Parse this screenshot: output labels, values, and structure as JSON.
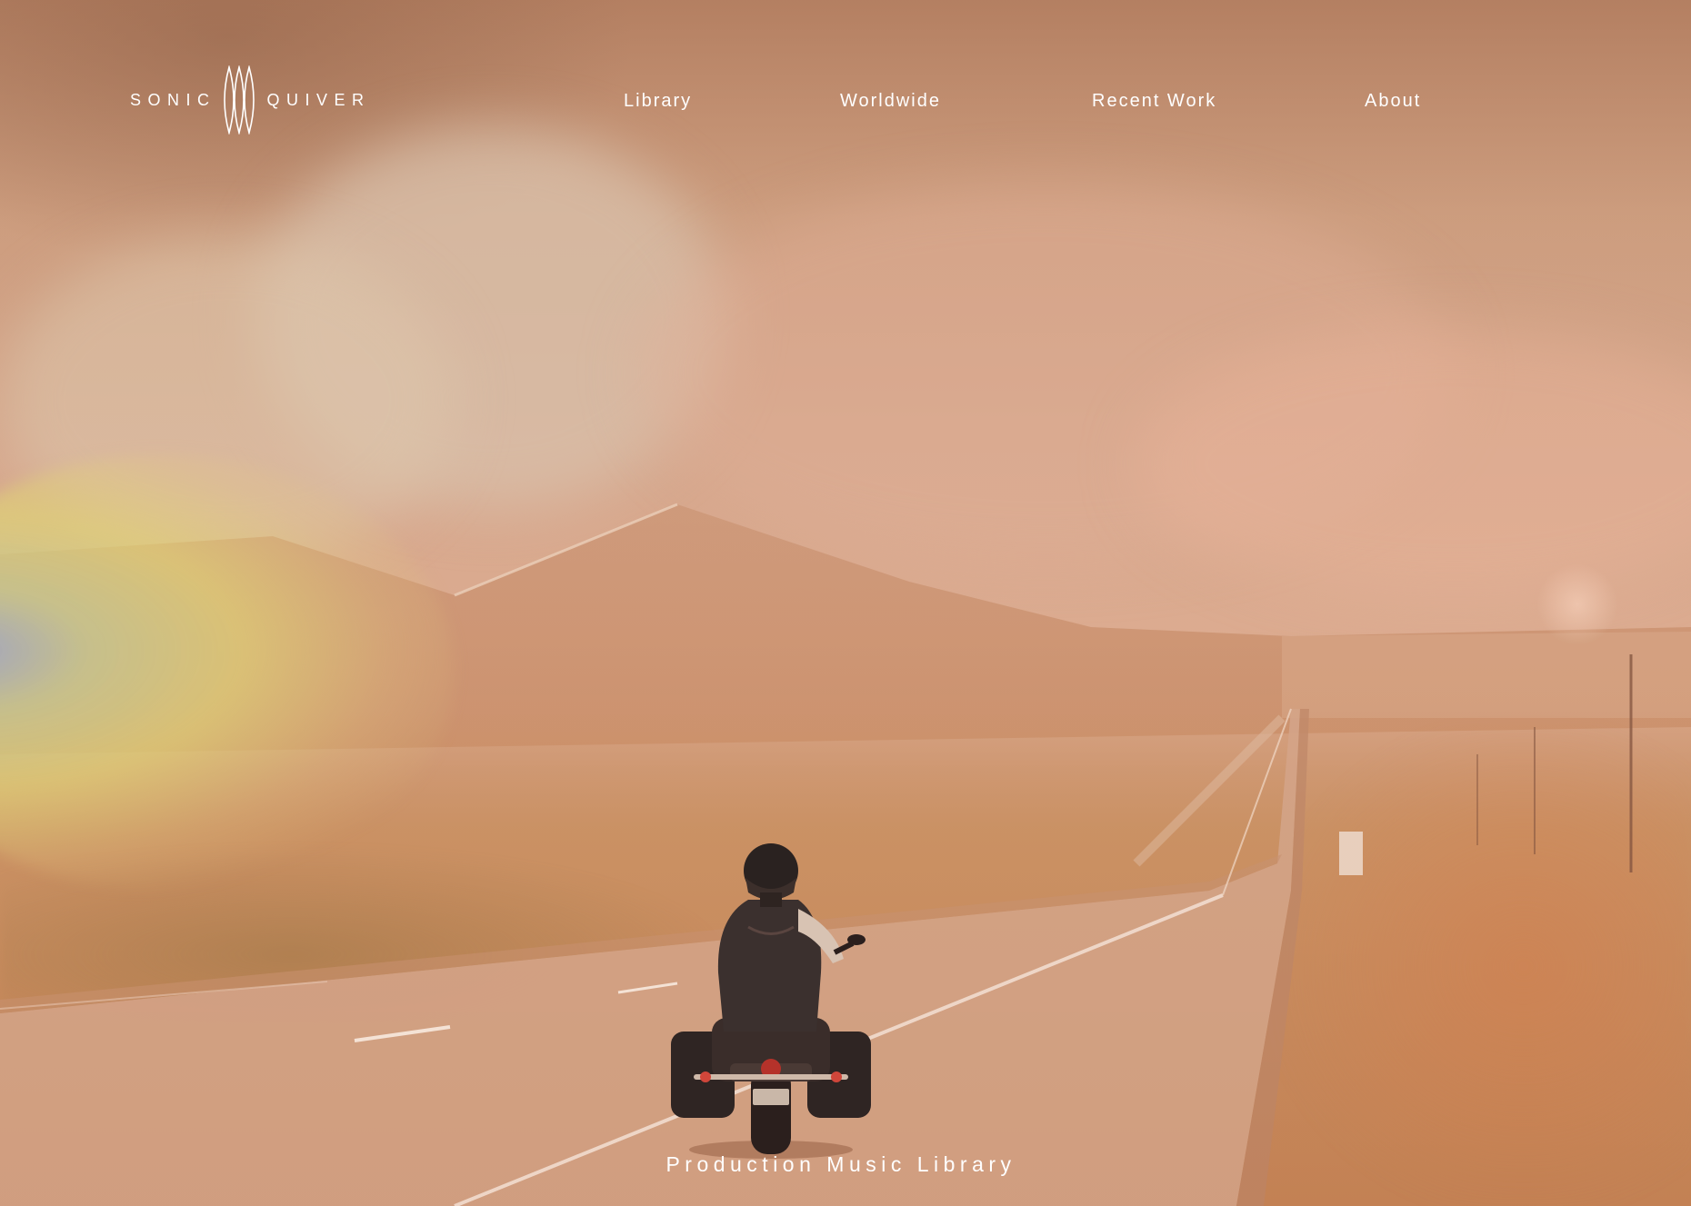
{
  "brand": {
    "word_left": "SONIC",
    "word_right": "QUIVER",
    "logo_icon": "quiver-arrows-icon"
  },
  "nav": {
    "items": [
      {
        "label": "Library"
      },
      {
        "label": "Worldwide"
      },
      {
        "label": "Recent Work"
      },
      {
        "label": "About"
      }
    ]
  },
  "hero": {
    "image": "motorcycle-rider-desert-highway",
    "tagline": "Production Music Library"
  },
  "colors": {
    "text": "#ffffff",
    "tint": "#c98d6c"
  }
}
